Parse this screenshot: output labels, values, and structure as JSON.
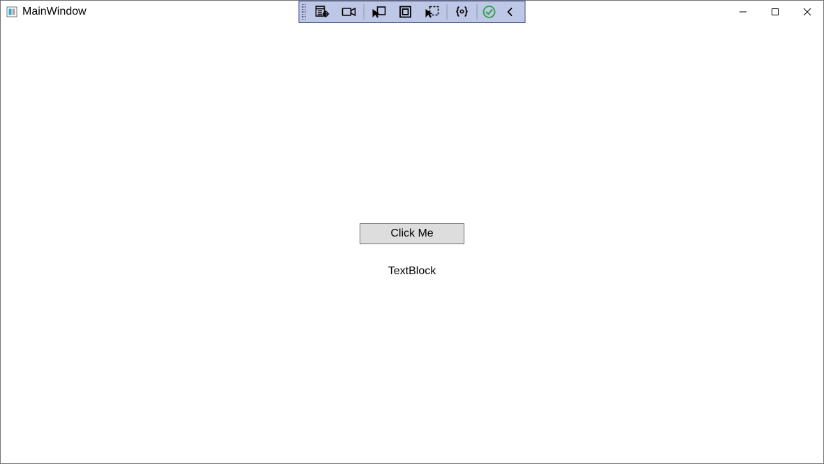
{
  "window": {
    "title": "MainWindow"
  },
  "content": {
    "button_label": "Click Me",
    "textblock_text": "TextBlock"
  },
  "debug_toolbar": {
    "items": [
      {
        "name": "go-to-live-visual-tree",
        "icon": "tree-target"
      },
      {
        "name": "recorder",
        "icon": "video"
      },
      {
        "name": "select-element",
        "icon": "cursor-box"
      },
      {
        "name": "display-layout-adorners",
        "icon": "square"
      },
      {
        "name": "track-focused-element",
        "icon": "cursor-square-dashed"
      },
      {
        "name": "show-binding-diagnostics",
        "icon": "braces-dot"
      },
      {
        "name": "hot-reload",
        "icon": "check-circle",
        "color": "#27a144"
      },
      {
        "name": "collapse",
        "icon": "chevron-left"
      }
    ]
  }
}
